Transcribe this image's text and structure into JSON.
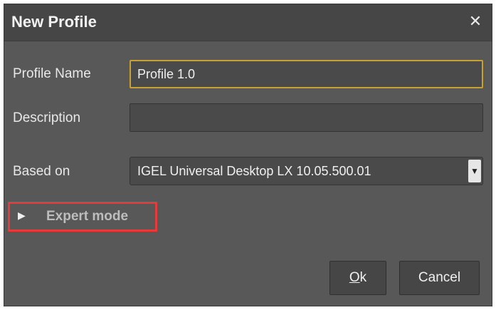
{
  "dialog": {
    "title": "New Profile",
    "close_icon": "close-icon"
  },
  "form": {
    "profile_name_label": "Profile Name",
    "profile_name_value": "Profile 1.0",
    "description_label": "Description",
    "description_value": "",
    "based_on_label": "Based on",
    "based_on_value": "IGEL Universal Desktop LX 10.05.500.01"
  },
  "expert": {
    "label": "Expert mode",
    "arrow": "▶"
  },
  "buttons": {
    "ok_mnemonic": "O",
    "ok_rest": "k",
    "cancel": "Cancel"
  },
  "colors": {
    "dialog_bg": "#585858",
    "titlebar_bg": "#464646",
    "focus_border": "#c8a12e",
    "highlight_border": "#e53b3b"
  }
}
